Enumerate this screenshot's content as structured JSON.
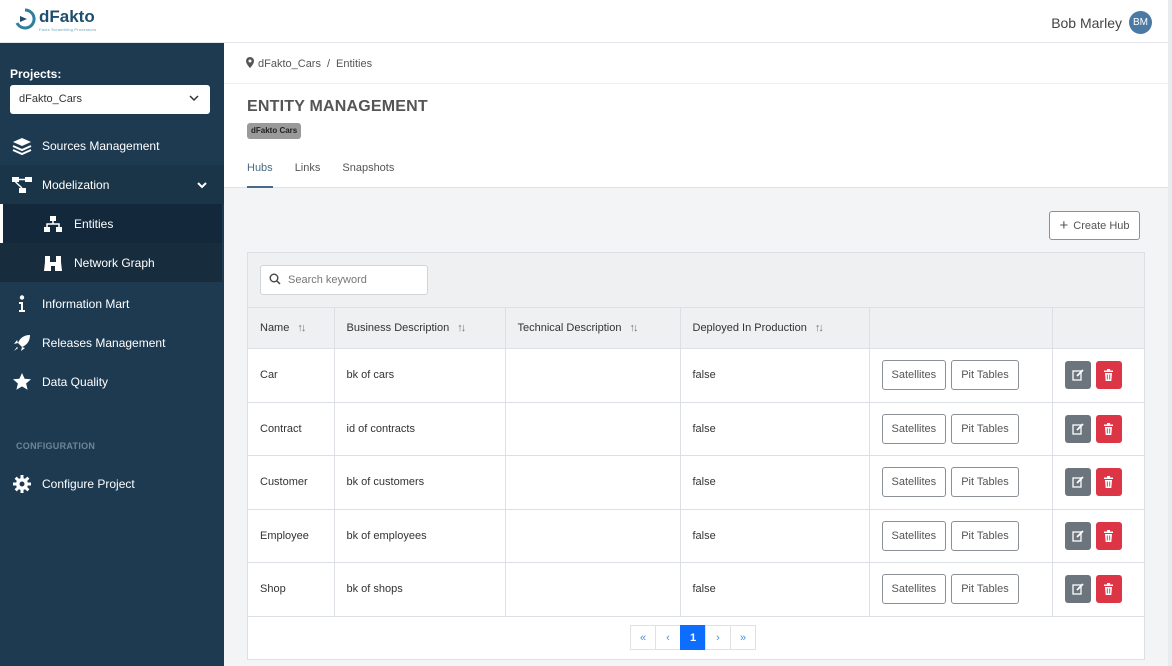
{
  "app": {
    "logo_name": "dFakto",
    "logo_tagline": "Facts Scrambling Processors"
  },
  "user": {
    "name": "Bob Marley",
    "initials": "BM"
  },
  "sidebar": {
    "projects_label": "Projects:",
    "project_selected": "dFakto_Cars",
    "items": [
      {
        "label": "Sources Management",
        "icon": "layers-icon"
      },
      {
        "label": "Modelization",
        "icon": "diagram-icon"
      },
      {
        "label": "Entities",
        "icon": "sitemap-icon"
      },
      {
        "label": "Network Graph",
        "icon": "binoculars-icon"
      },
      {
        "label": "Information Mart",
        "icon": "info-icon"
      },
      {
        "label": "Releases Management",
        "icon": "rocket-icon"
      },
      {
        "label": "Data Quality",
        "icon": "star-icon"
      }
    ],
    "config_label": "CONFIGURATION",
    "configure_project": "Configure Project"
  },
  "breadcrumb": {
    "project": "dFakto_Cars",
    "page": "Entities"
  },
  "page": {
    "title": "ENTITY MANAGEMENT",
    "badge": "dFakto Cars",
    "tabs": [
      "Hubs",
      "Links",
      "Snapshots"
    ],
    "active_tab": "Hubs",
    "create_label": "Create Hub"
  },
  "search": {
    "placeholder": "Search keyword"
  },
  "table": {
    "columns": [
      "Name",
      "Business Description",
      "Technical Description",
      "Deployed In Production"
    ],
    "satellites_label": "Satellites",
    "pit_label": "Pit Tables",
    "rows": [
      {
        "name": "Car",
        "business": "bk of cars",
        "technical": "",
        "deployed": "false"
      },
      {
        "name": "Contract",
        "business": "id of contracts",
        "technical": "",
        "deployed": "false"
      },
      {
        "name": "Customer",
        "business": "bk of customers",
        "technical": "",
        "deployed": "false"
      },
      {
        "name": "Employee",
        "business": "bk of employees",
        "technical": "",
        "deployed": "false"
      },
      {
        "name": "Shop",
        "business": "bk of shops",
        "technical": "",
        "deployed": "false"
      }
    ]
  },
  "pagination": {
    "first": "«",
    "prev": "‹",
    "current": "1",
    "next": "›",
    "last": "»"
  }
}
